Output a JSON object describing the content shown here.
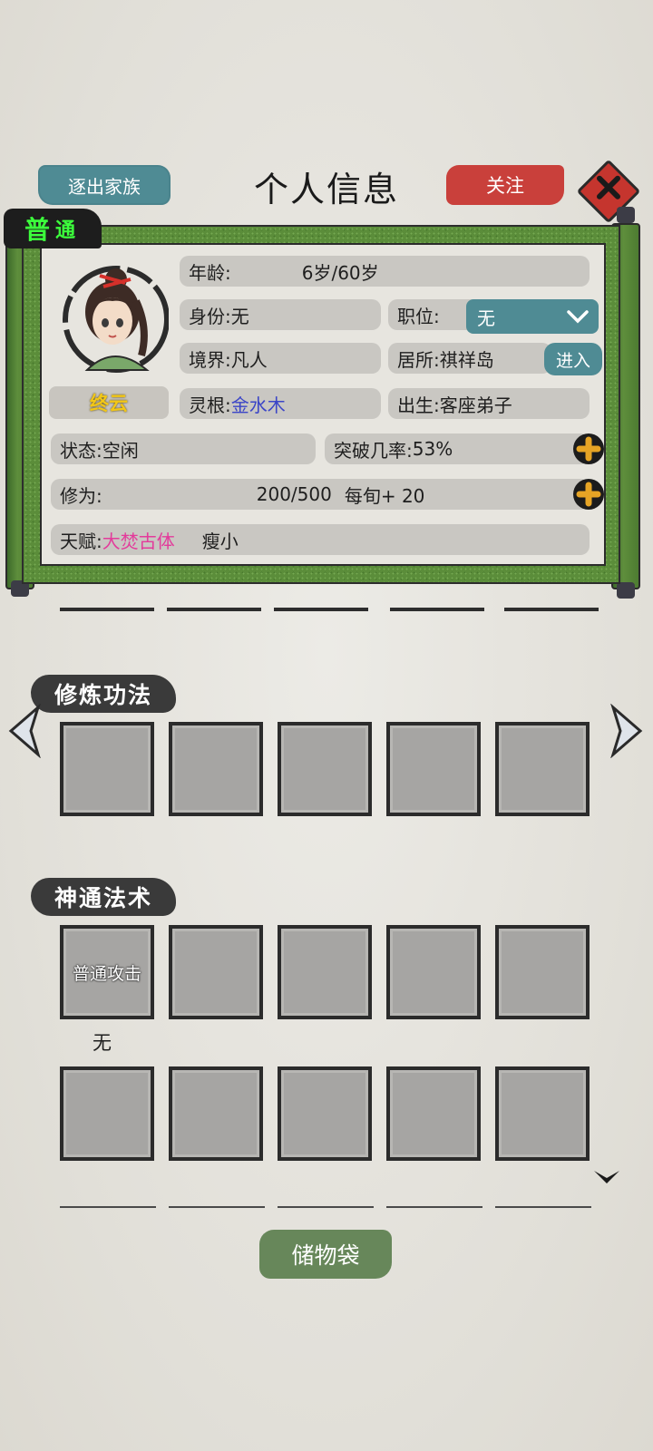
{
  "header": {
    "expel_label": "逐出家族",
    "title": "个人信息",
    "follow_label": "关注"
  },
  "rank": {
    "char1": "普",
    "char2": "通"
  },
  "character": {
    "name": "终云",
    "age_label": "年龄:",
    "age_value": "6岁/60岁",
    "identity_label": "身份:",
    "identity_value": "无",
    "job_label": "职位:",
    "job_value": "无",
    "realm_label": "境界:",
    "realm_value": "凡人",
    "residence_label": "居所:",
    "residence_value": "祺祥岛",
    "enter_label": "进入",
    "root_label": "灵根:",
    "root_value": "金水木",
    "origin_label": "出生:",
    "origin_value": "客座弟子",
    "status_label": "状态:",
    "status_value": "空闲",
    "breakthrough_label": "突破几率:",
    "breakthrough_value": "53%",
    "cultivation_label": "修为:",
    "cultivation_value": "200/500",
    "cultivation_rate": "每旬+ 20",
    "talent_label": "天赋:",
    "talent_value": "大焚古体",
    "talent_extra": "瘦小"
  },
  "sections": {
    "techniques_title": "修炼功法",
    "spells_title": "神通法术",
    "spell_slot1_label": "普通攻击",
    "spell_slot1_sub": "无"
  },
  "storage_label": "储物袋",
  "colors": {
    "teal_button": "#4f8b94",
    "red_button": "#c9403b",
    "green_frame": "#5b8d3a",
    "rank_green": "#3cff3c",
    "name_gold": "#f2c717",
    "root_blue": "#3b45c7",
    "talent_pink": "#e33b9b"
  }
}
